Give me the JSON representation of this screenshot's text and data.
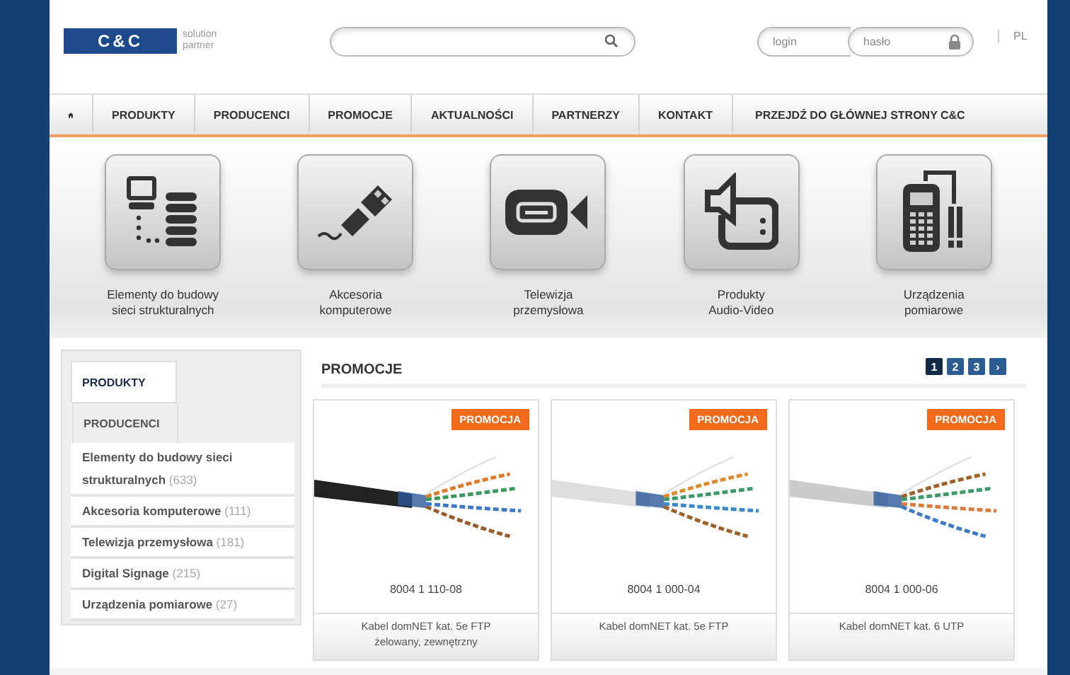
{
  "header": {
    "logo": {
      "name": "C&C",
      "tagline_1": "solution",
      "tagline_2": "partner"
    },
    "login": {
      "placeholder": "login"
    },
    "password": {
      "placeholder": "hasło"
    },
    "language": "PL"
  },
  "nav": {
    "items": [
      {
        "kind": "home"
      },
      {
        "kind": "link",
        "label": "PRODUKTY"
      },
      {
        "kind": "link",
        "label": "PRODUCENCI"
      },
      {
        "kind": "link",
        "label": "PROMOCJE"
      },
      {
        "kind": "link",
        "label": "AKTUALNOŚCI"
      },
      {
        "kind": "link",
        "label": "PARTNERZY"
      },
      {
        "kind": "link",
        "label": "KONTAKT"
      },
      {
        "kind": "link",
        "label": "PRZEJDŹ DO GŁÓWNEJ STRONY C&C"
      }
    ]
  },
  "categories": [
    {
      "kind": "network",
      "line_1": "Elementy do budowy",
      "line_2": "sieci strukturalnych"
    },
    {
      "kind": "usb",
      "line_1": "Akcesoria",
      "line_2": "komputerowe"
    },
    {
      "kind": "camera",
      "line_1": "Telewizja",
      "line_2": "przemysłowa"
    },
    {
      "kind": "audio",
      "line_1": "Produkty",
      "line_2": "Audio-Video"
    },
    {
      "kind": "meter",
      "line_1": "Urządzenia",
      "line_2": "pomiarowe"
    }
  ],
  "sidebar": {
    "tabs": [
      {
        "label": "PRODUKTY",
        "selected": true
      },
      {
        "label": "PRODUCENCI",
        "selected": false
      }
    ],
    "items": [
      {
        "name": "Elementy do budowy sieci strukturalnych",
        "count": "(633)"
      },
      {
        "name": "Akcesoria komputerowe",
        "count": "(111)"
      },
      {
        "name": "Telewizja przemysłowa",
        "count": "(181)"
      },
      {
        "name": "Digital Signage",
        "count": "(215)"
      },
      {
        "name": "Urządzenia pomiarowe",
        "count": "(27)"
      }
    ]
  },
  "promotions": {
    "title": "PROMOCJE",
    "pages": [
      {
        "label": "1",
        "selected": true
      },
      {
        "label": "2",
        "selected": false
      },
      {
        "label": "3",
        "selected": false
      }
    ],
    "next": "›",
    "products": [
      {
        "badge": "PROMOCJA",
        "code": "8004 1 110-08",
        "name_1": "Kabel domNET kat. 5e FTP",
        "name_2": "żelowany, zewnętrzny"
      },
      {
        "badge": "PROMOCJA",
        "code": "8004 1 000-04",
        "name_1": "Kabel domNET kat. 5e FTP"
      },
      {
        "badge": "PROMOCJA",
        "code": "8004 1 000-06",
        "name_1": "Kabel domNET kat. 6 UTP"
      }
    ]
  }
}
